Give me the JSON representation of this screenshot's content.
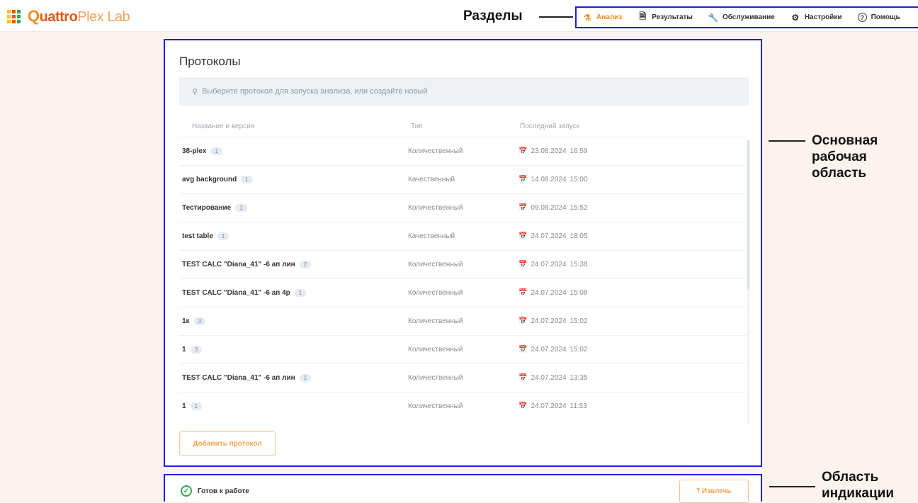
{
  "header": {
    "logo": {
      "q": "Q",
      "quattro": "uattro",
      "plex": "Plex Lab",
      "grid_colors": [
        "#f6c11b",
        "#e8581a",
        "#2eab4e",
        "#f6c11b",
        "#e8581a",
        "#2eab4e",
        "#f6c11b",
        "#e8581a",
        "#2eab4e"
      ]
    },
    "nav": [
      {
        "label": "Анализ",
        "icon": "flask-icon",
        "active": true
      },
      {
        "label": "Результаты",
        "icon": "document-icon",
        "active": false
      },
      {
        "label": "Обслуживание",
        "icon": "wrench-icon",
        "active": false
      },
      {
        "label": "Настройки",
        "icon": "gear-icon",
        "active": false
      },
      {
        "label": "Помощь",
        "icon": "help-icon",
        "active": false
      }
    ]
  },
  "annotations": {
    "sections": "Разделы",
    "workspace": [
      "Основная",
      "рабочая",
      "область"
    ],
    "indication": [
      "Область",
      "индикации"
    ]
  },
  "protocols": {
    "title": "Протоколы",
    "hint": "Выберите протокол для запуска анализа, или создайте новый",
    "columns": {
      "name": "Название и версия",
      "type": "Тип",
      "last_run": "Последний запуск"
    },
    "rows": [
      {
        "name": "38-plex",
        "version": "1",
        "type": "Количественный",
        "date": "23.08.2024",
        "time": "16:59"
      },
      {
        "name": "avg background",
        "version": "1",
        "type": "Качественный",
        "date": "14.08.2024",
        "time": "15:00"
      },
      {
        "name": "Тестирование",
        "version": "1",
        "type": "Количественный",
        "date": "09.08.2024",
        "time": "15:52"
      },
      {
        "name": "test table",
        "version": "1",
        "type": "Качественный",
        "date": "24.07.2024",
        "time": "18:05"
      },
      {
        "name": "TEST CALC \"Diana_41\" -6 ап лин",
        "version": "2",
        "type": "Количественный",
        "date": "24.07.2024",
        "time": "15:38"
      },
      {
        "name": "TEST CALC \"Diana_41\" -6 ап 4р",
        "version": "1",
        "type": "Количественный",
        "date": "24.07.2024",
        "time": "15:08"
      },
      {
        "name": "1к",
        "version": "3",
        "type": "Количественный",
        "date": "24.07.2024",
        "time": "15:02"
      },
      {
        "name": "1",
        "version": "3",
        "type": "Количественный",
        "date": "24.07.2024",
        "time": "15:02"
      },
      {
        "name": "TEST CALC \"Diana_41\" -6 ап лин",
        "version": "1",
        "type": "Количественный",
        "date": "24.07.2024",
        "time": "13:35"
      },
      {
        "name": "1",
        "version": "1",
        "type": "Количественный",
        "date": "24.07.2024",
        "time": "11:53"
      }
    ],
    "add_button": "Добавить протокол"
  },
  "status": {
    "text": "Готов к работе",
    "eject_button": "Извлечь"
  },
  "colors": {
    "accent": "#f08c1c",
    "annotation_border": "#1d1de6",
    "ok": "#2eab4e"
  }
}
